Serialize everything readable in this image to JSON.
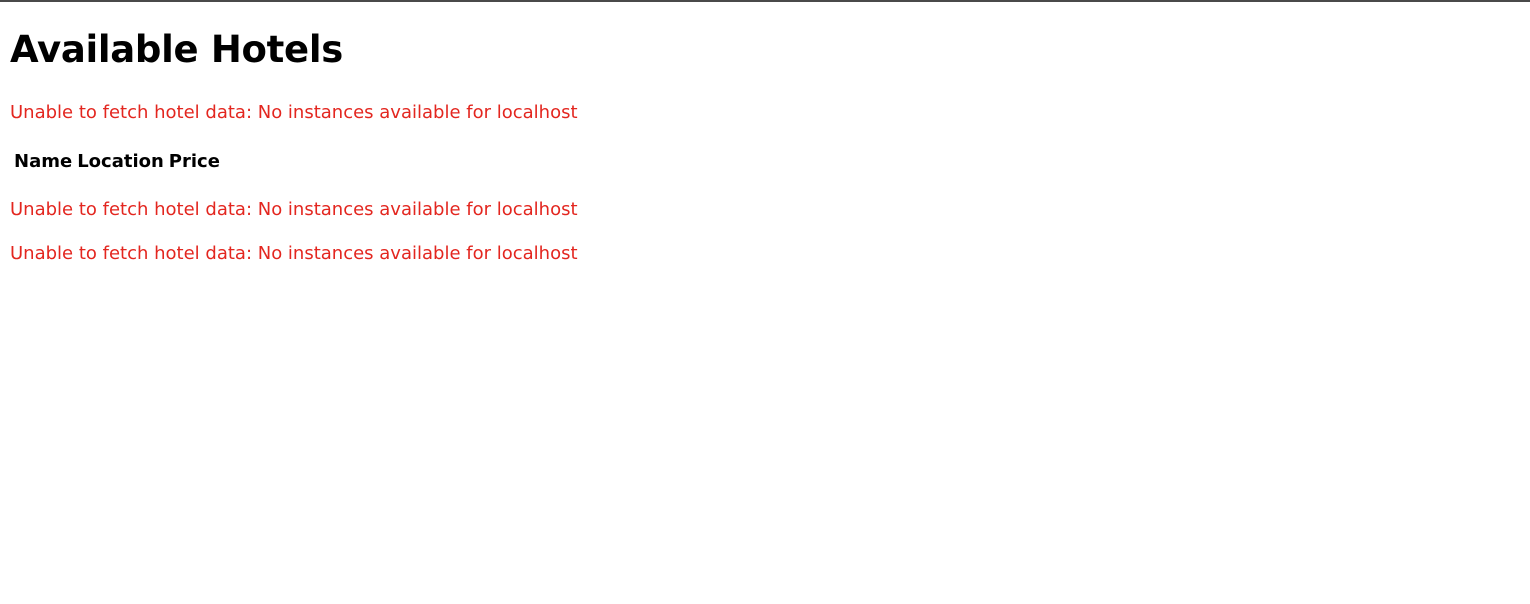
{
  "page": {
    "title": "Available Hotels"
  },
  "colors": {
    "error": "#e3261f",
    "text": "#000000"
  },
  "errors": [
    "Unable to fetch hotel data: No instances available for localhost",
    "Unable to fetch hotel data: No instances available for localhost",
    "Unable to fetch hotel data: No instances available for localhost"
  ],
  "table": {
    "columns": [
      "Name",
      "Location",
      "Price"
    ]
  }
}
